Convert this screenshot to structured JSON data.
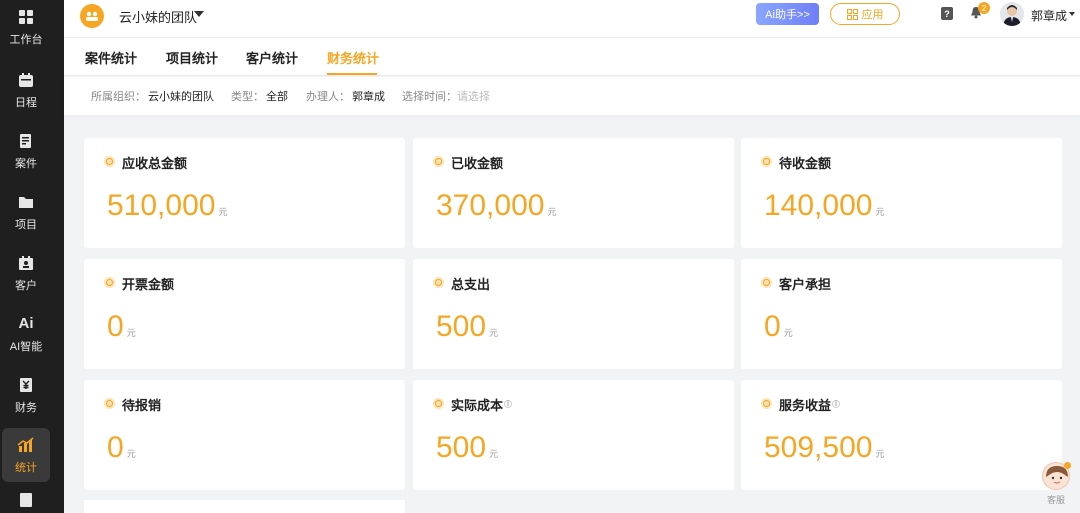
{
  "sidebar": {
    "items": [
      {
        "label": "工作台",
        "icon": "dashboard-icon"
      },
      {
        "label": "日程",
        "icon": "calendar-icon"
      },
      {
        "label": "案件",
        "icon": "case-icon"
      },
      {
        "label": "项目",
        "icon": "folder-icon"
      },
      {
        "label": "客户",
        "icon": "contacts-icon"
      },
      {
        "label": "AI智能",
        "icon": "ai-icon"
      },
      {
        "label": "财务",
        "icon": "finance-icon"
      },
      {
        "label": "统计",
        "icon": "chart-icon",
        "active": true
      }
    ]
  },
  "header": {
    "team_name": "云小妹的团队",
    "ai_button": "Ai助手>>",
    "apps_button": "应用",
    "notification_count": "2",
    "user_name": "郭章成"
  },
  "tabs": [
    {
      "label": "案件统计"
    },
    {
      "label": "项目统计"
    },
    {
      "label": "客户统计"
    },
    {
      "label": "财务统计",
      "active": true
    }
  ],
  "filters": {
    "org_label": "所属组织：",
    "org_value": "云小妹的团队",
    "type_label": "类型：",
    "type_value": "全部",
    "handler_label": "办理人：",
    "handler_value": "郭章成",
    "time_label": "选择时间：",
    "time_placeholder": "请选择"
  },
  "cards": [
    {
      "title": "应收总金额",
      "value": "510,000",
      "unit": "元"
    },
    {
      "title": "已收金额",
      "value": "370,000",
      "unit": "元"
    },
    {
      "title": "待收金额",
      "value": "140,000",
      "unit": "元"
    },
    {
      "title": "开票金额",
      "value": "0",
      "unit": "元"
    },
    {
      "title": "总支出",
      "value": "500",
      "unit": "元"
    },
    {
      "title": "客户承担",
      "value": "0",
      "unit": "元"
    },
    {
      "title": "待报销",
      "value": "0",
      "unit": "元"
    },
    {
      "title": "实际成本",
      "value": "500",
      "unit": "元",
      "info": "i"
    },
    {
      "title": "服务收益",
      "value": "509,500",
      "unit": "元",
      "info": "i"
    }
  ],
  "support": {
    "label": "客服"
  },
  "colors": {
    "accent": "#f5a623",
    "sidebar_bg": "#1f1f1f",
    "ai_button": "#7b8ff9"
  }
}
